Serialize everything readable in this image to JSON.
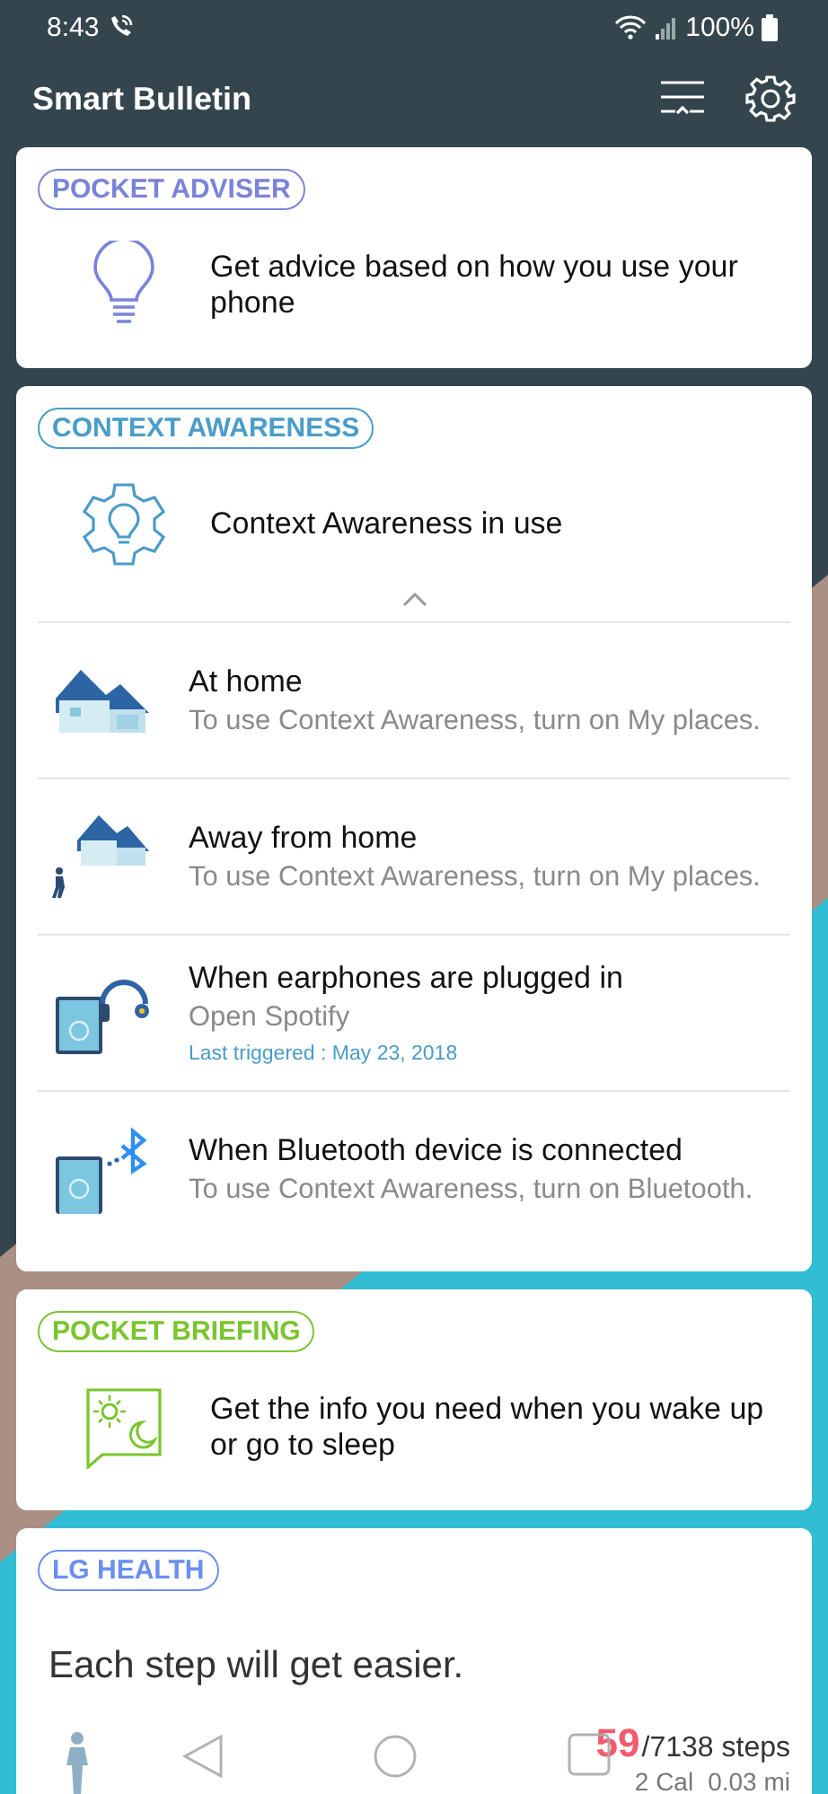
{
  "status_bar": {
    "time": "8:43",
    "battery": "100%"
  },
  "header": {
    "title": "Smart Bulletin"
  },
  "cards": [
    {
      "kind": "adviser",
      "tag": "POCKET ADVISER",
      "color": "#7b83d9",
      "text": "Get advice based on how you use your phone"
    },
    {
      "kind": "context",
      "tag": "CONTEXT AWARENESS",
      "color": "#4a9cc9",
      "text": "Context Awareness in use",
      "expanded": true,
      "items": [
        {
          "kind": "home",
          "title": "At home",
          "subtitle": "To use Context Awareness, turn on My places."
        },
        {
          "kind": "away",
          "title": "Away from home",
          "subtitle": "To use Context Awareness, turn on My places."
        },
        {
          "kind": "earphones",
          "title": "When earphones are plugged in",
          "subtitle": "Open Spotify",
          "note": "Last triggered : May 23, 2018"
        },
        {
          "kind": "bluetooth",
          "title": "When Bluetooth device is connected",
          "subtitle": "To use Context Awareness, turn on Bluetooth."
        }
      ]
    },
    {
      "kind": "briefing",
      "tag": "POCKET BRIEFING",
      "color": "#7ac52e",
      "text": "Get the info you need when you wake up or go to sleep"
    },
    {
      "kind": "health",
      "tag": "LG HEALTH",
      "color": "#6b8ff0",
      "text": "Each step will get easier.",
      "steps": "59",
      "goal": "/7138 steps",
      "calories": "2 Cal",
      "distance": "0.03 mi"
    }
  ]
}
